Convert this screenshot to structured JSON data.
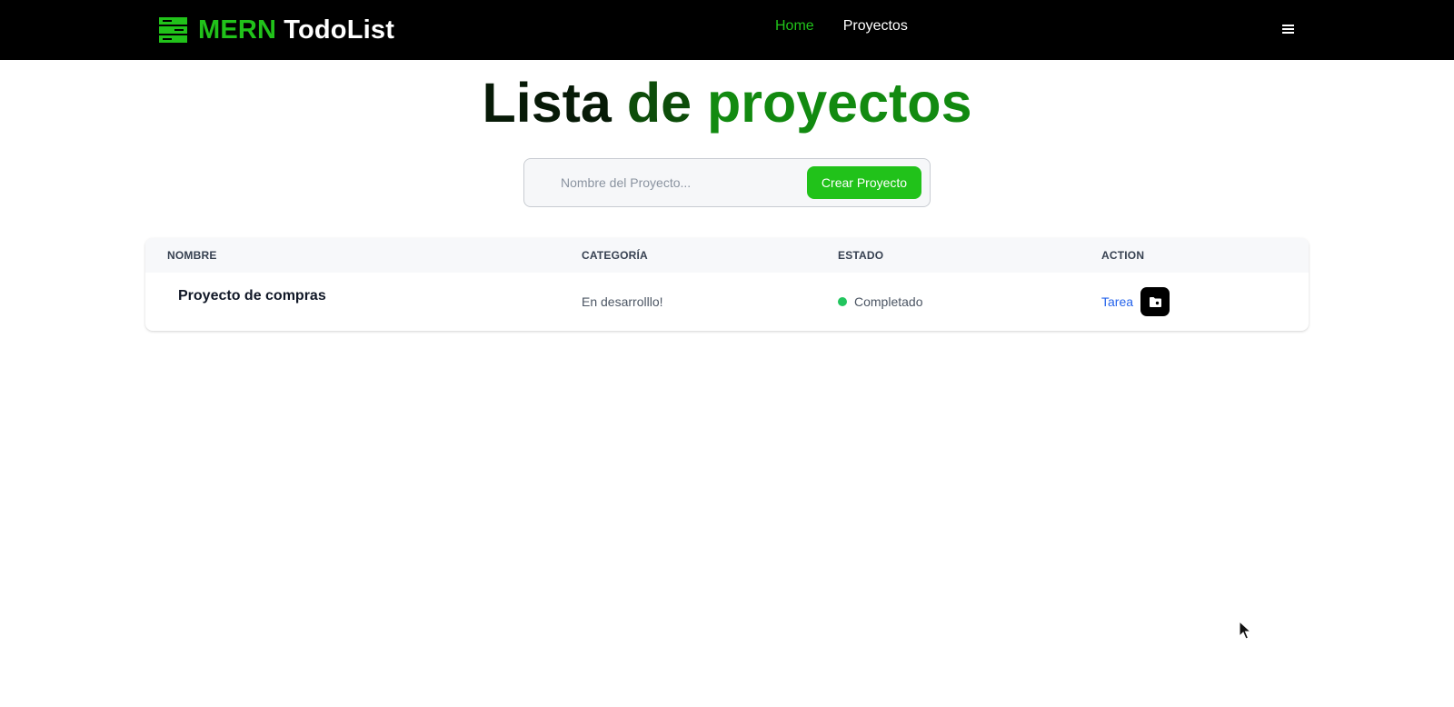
{
  "navbar": {
    "brand_mern": "MERN",
    "brand_todo": "TodoList",
    "brand_icon": "server-stack-icon",
    "links": [
      {
        "label": "Home",
        "active": true
      },
      {
        "label": "Proyectos",
        "active": false
      }
    ],
    "menu_icon": "hamburger-menu-icon"
  },
  "page": {
    "title_words": [
      "Lista",
      "de",
      "proyectos"
    ]
  },
  "form": {
    "placeholder": "Nombre del Proyecto...",
    "value": "",
    "create_label": "Crear Proyecto"
  },
  "table": {
    "headers": {
      "name": "NOMBRE",
      "category": "CATEGORÍA",
      "status": "ESTADO",
      "action": "ACTION"
    },
    "rows": [
      {
        "name": "Proyecto de compras",
        "category": "En desarrolllo!",
        "status": "Completado",
        "action_link": "Tarea",
        "action_icon": "folder-icon"
      }
    ]
  },
  "colors": {
    "accent": "#21c21a",
    "navbar_bg": "#000000",
    "link_blue": "#2563eb",
    "status_green": "#22c55e"
  }
}
